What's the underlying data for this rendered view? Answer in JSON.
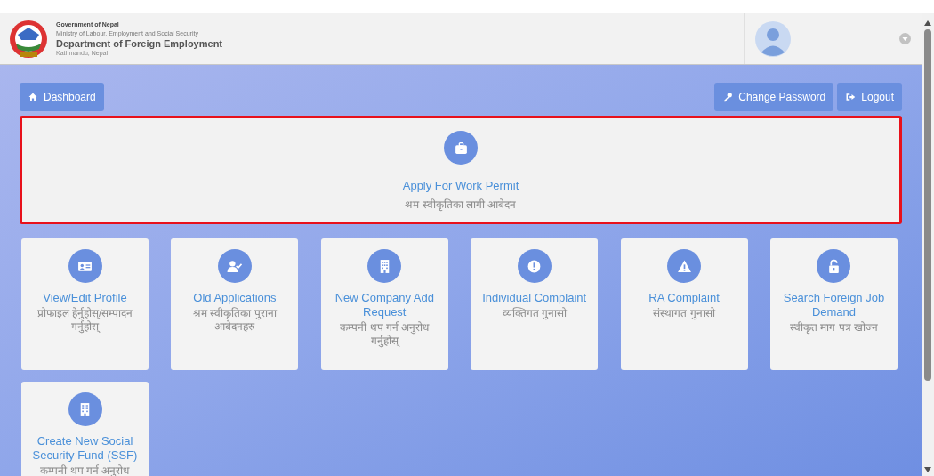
{
  "header": {
    "lines": [
      "Government of Nepal",
      "Ministry of Labour, Employment and Social Security",
      "Department of Foreign Employment",
      "Kathmandu, Nepal"
    ]
  },
  "toolbar": {
    "left": [
      {
        "label": "Dashboard"
      }
    ],
    "right": [
      {
        "label": "Change Password"
      },
      {
        "label": "Logout"
      }
    ]
  },
  "featured": {
    "title": "Apply For Work Permit",
    "subtitle": "श्रम स्वीकृतिका लागी आबेदन",
    "highlighted": true
  },
  "cards": [
    {
      "title": "View/Edit Profile",
      "subtitle": "प्रोफाइल हेर्नुहोस्/सम्पादन गर्नुहोस्"
    },
    {
      "title": "Old Applications",
      "subtitle": "श्रम स्वीकृतिका पुराना आबेदनहरु"
    },
    {
      "title": "New Company Add Request",
      "subtitle": "कम्पनी थप गर्न अनुरोध गर्नुहोस्"
    },
    {
      "title": "Individual Complaint",
      "subtitle": "व्यक्तिगत गुनासो"
    },
    {
      "title": "RA Complaint",
      "subtitle": "संस्थागत गुनासो"
    },
    {
      "title": "Search Foreign Job Demand",
      "subtitle": "स्वीकृत माग पत्र खोज्न"
    },
    {
      "title": "Create New Social Security Fund (SSF)",
      "subtitle": "कम्पनी थप गर्न अनुरोध"
    }
  ]
}
